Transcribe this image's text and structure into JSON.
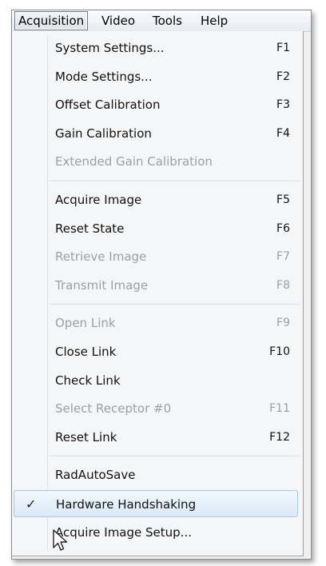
{
  "menubar": {
    "items": [
      "Acquisition",
      "Video",
      "Tools",
      "Help"
    ]
  },
  "menu": {
    "groups": [
      [
        {
          "label": "System Settings...",
          "shortcut": "F1",
          "enabled": true
        },
        {
          "label": "Mode Settings...",
          "shortcut": "F2",
          "enabled": true
        },
        {
          "label": "Offset Calibration",
          "shortcut": "F3",
          "enabled": true
        },
        {
          "label": "Gain Calibration",
          "shortcut": "F4",
          "enabled": true
        },
        {
          "label": "Extended Gain Calibration",
          "shortcut": "",
          "enabled": false
        }
      ],
      [
        {
          "label": "Acquire Image",
          "shortcut": "F5",
          "enabled": true
        },
        {
          "label": "Reset State",
          "shortcut": "F6",
          "enabled": true
        },
        {
          "label": "Retrieve Image",
          "shortcut": "F7",
          "enabled": false
        },
        {
          "label": "Transmit Image",
          "shortcut": "F8",
          "enabled": false
        }
      ],
      [
        {
          "label": "Open Link",
          "shortcut": "F9",
          "enabled": false
        },
        {
          "label": "Close Link",
          "shortcut": "F10",
          "enabled": true
        },
        {
          "label": "Check Link",
          "shortcut": "",
          "enabled": true
        },
        {
          "label": "Select Receptor #0",
          "shortcut": "F11",
          "enabled": false
        },
        {
          "label": "Reset Link",
          "shortcut": "F12",
          "enabled": true
        }
      ],
      [
        {
          "label": "RadAutoSave",
          "shortcut": "",
          "enabled": true
        },
        {
          "label": "Hardware Handshaking",
          "shortcut": "",
          "enabled": true,
          "checked": true,
          "highlighted": true
        },
        {
          "label": "Acquire Image Setup...",
          "shortcut": "",
          "enabled": true
        }
      ]
    ],
    "check_mark": "✓"
  },
  "colors": {
    "highlight_border": "#a8c9ea",
    "disabled_text": "#9aa0a6"
  }
}
